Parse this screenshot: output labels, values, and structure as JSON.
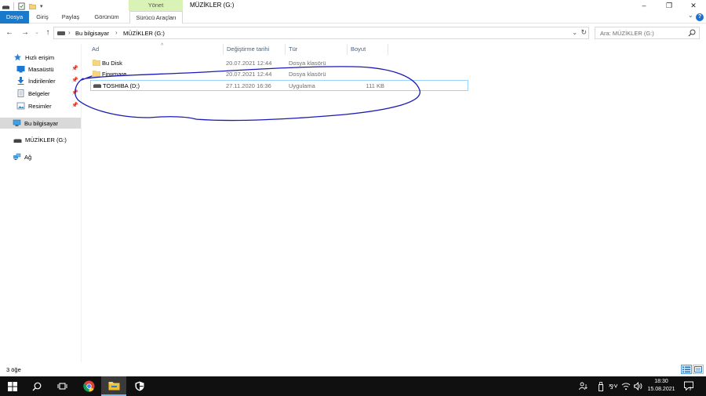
{
  "window": {
    "title": "MÜZİKLER (G:)",
    "manage_tab": "Yönet",
    "minimize": "–",
    "maximize": "❐",
    "close": "✕"
  },
  "ribbon": {
    "tabs": [
      "Dosya",
      "Giriş",
      "Paylaş",
      "Görünüm",
      "Sürücü Araçları"
    ],
    "help": "?",
    "expand": "⌄"
  },
  "address": {
    "breadcrumb": [
      "Bu bilgisayar",
      "MÜZİKLER (G:)"
    ],
    "search_placeholder": "Ara: MÜZİKLER (G:)"
  },
  "nav": {
    "items": [
      {
        "label": "Hızlı erişim",
        "icon": "star-icon"
      },
      {
        "label": "Masaüstü",
        "icon": "desktop-icon",
        "pinned": true
      },
      {
        "label": "İndirilenler",
        "icon": "download-icon",
        "pinned": true
      },
      {
        "label": "Belgeler",
        "icon": "document-icon",
        "pinned": true
      },
      {
        "label": "Resimler",
        "icon": "pictures-icon",
        "pinned": true
      },
      {
        "label": "Bu bilgisayar",
        "icon": "computer-icon"
      },
      {
        "label": "MÜZİKLER (G:)",
        "icon": "drive-icon"
      },
      {
        "label": "Ağ",
        "icon": "network-icon"
      }
    ]
  },
  "columns": {
    "name": "Ad",
    "date": "Değiştirme tarihi",
    "type": "Tür",
    "size": "Boyut"
  },
  "files": [
    {
      "name": "Bu Disk",
      "date": "20.07.2021 12:44",
      "type": "Dosya klasörü",
      "size": ""
    },
    {
      "name": "Firwmare",
      "date": "20.07.2021 12:44",
      "type": "Dosya klasörü",
      "size": ""
    },
    {
      "name": "TOSHIBA (D;)",
      "date": "27.11.2020 16:36",
      "type": "Uygulama",
      "size": "111 KB"
    }
  ],
  "status": {
    "item_count": "3 öğe"
  },
  "taskbar": {
    "time": "18:30",
    "date": "15.08.2021"
  },
  "colors": {
    "file_tab": "#1979ca",
    "manage_tab": "#d9f2b6",
    "annotation_ink": "#1a1ab4",
    "taskbar": "#101010"
  }
}
